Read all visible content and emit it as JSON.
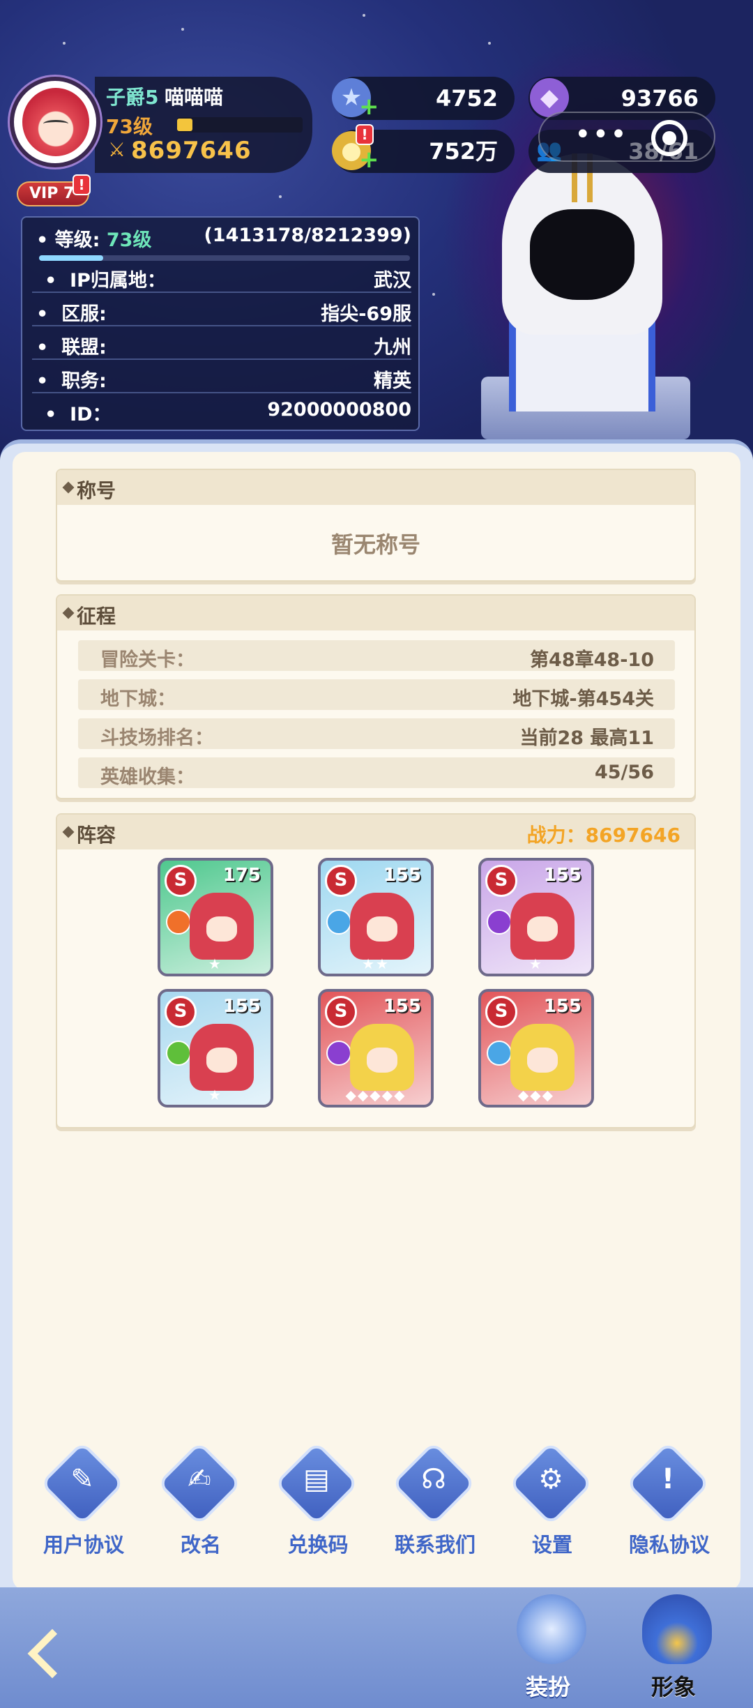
{
  "profile": {
    "rank": "子爵5",
    "nickname": "喵喵喵",
    "level_label": "73级",
    "level_progress_fraction": 0.12,
    "power": "8697646",
    "vip": "VIP 7"
  },
  "currencies": {
    "star_gem": "4752",
    "gold": "752万",
    "purple_gem": "93766",
    "friends": "38/61"
  },
  "info": {
    "level_label": "等级:",
    "level_value": "73级",
    "level_exp": "(1413178/8212399)",
    "level_progress_fraction": 0.172,
    "rows": [
      {
        "label": "IP归属地：",
        "value": "武汉"
      },
      {
        "label": "区服:",
        "value": "指尖-69服"
      },
      {
        "label": "联盟:",
        "value": "九州"
      },
      {
        "label": "职务:",
        "value": "精英"
      },
      {
        "label": "ID：",
        "value": "92000000800"
      }
    ]
  },
  "title_section": {
    "heading": "称号",
    "empty_text": "暂无称号"
  },
  "journey": {
    "heading": "征程",
    "rows": [
      {
        "label": "冒险关卡：",
        "value": "第48章48-10"
      },
      {
        "label": "地下城：",
        "value": "地下城-第454关"
      },
      {
        "label": "斗技场排名：",
        "value": "当前28 最高11"
      },
      {
        "label": "英雄收集：",
        "value": "45/56"
      }
    ]
  },
  "lineup": {
    "heading": "阵容",
    "power_label": "战力：8697646",
    "heroes": [
      {
        "level": "175",
        "rank": "S",
        "bg": "#4fc88e",
        "element": "fire",
        "stars": "★"
      },
      {
        "level": "155",
        "rank": "S",
        "bg": "#9fd8f0",
        "element": "ice",
        "stars": "★★"
      },
      {
        "level": "155",
        "rank": "S",
        "bg": "#c9a6e8",
        "element": "void",
        "stars": "★"
      },
      {
        "level": "155",
        "rank": "S",
        "bg": "#a8d8ef",
        "element": "nature",
        "stars": "★"
      },
      {
        "level": "155",
        "rank": "S",
        "bg": "#e2565a",
        "element": "void",
        "stars": "◆◆◆◆◆"
      },
      {
        "level": "155",
        "rank": "S",
        "bg": "#e2565a",
        "element": "ice",
        "stars": "◆◆◆"
      }
    ]
  },
  "buttons": [
    {
      "label": "用户协议",
      "icon": "document-edit-icon",
      "glyph": "✎"
    },
    {
      "label": "改名",
      "icon": "rename-icon",
      "glyph": "✍"
    },
    {
      "label": "兑换码",
      "icon": "ticket-icon",
      "glyph": "▤"
    },
    {
      "label": "联系我们",
      "icon": "headset-icon",
      "glyph": "☊"
    },
    {
      "label": "设置",
      "icon": "gear-icon",
      "glyph": "⚙"
    },
    {
      "label": "隐私协议",
      "icon": "shield-icon",
      "glyph": "!"
    }
  ],
  "nav": {
    "dress_up": "装扮",
    "appearance": "形象"
  }
}
